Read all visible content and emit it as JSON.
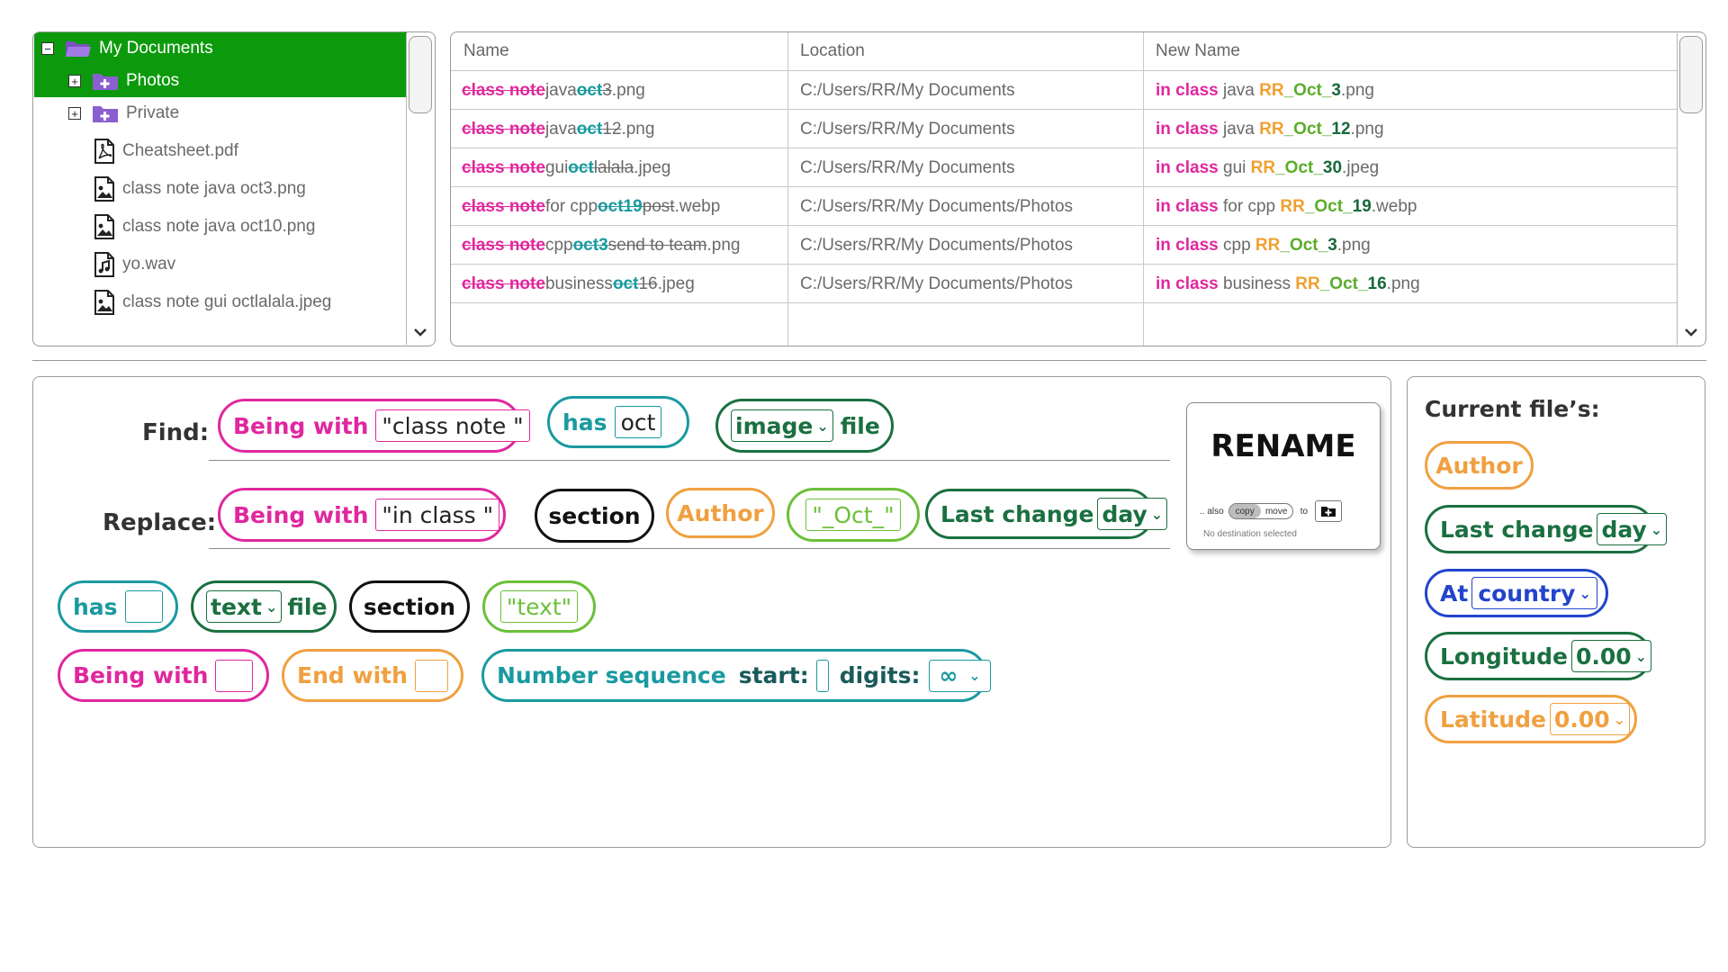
{
  "tree": {
    "items": [
      {
        "label": "My Documents",
        "type": "folder-open",
        "expander": "−",
        "selected": true
      },
      {
        "label": "Photos",
        "type": "folder",
        "expander": "+",
        "selected": true
      },
      {
        "label": "Private",
        "type": "folder",
        "expander": "+",
        "selected": false
      },
      {
        "label": "Cheatsheet.pdf",
        "type": "pdf"
      },
      {
        "label": "class note java oct3.png",
        "type": "image"
      },
      {
        "label": "class note java oct10.png",
        "type": "image"
      },
      {
        "label": "yo.wav",
        "type": "audio"
      },
      {
        "label": "class note gui octlalala.jpeg",
        "type": "image"
      }
    ]
  },
  "table": {
    "headers": {
      "name": "Name",
      "location": "Location",
      "new_name": "New Name"
    },
    "rows": [
      {
        "name": {
          "p1": "class note ",
          "p2": "java ",
          "p3": "oct",
          "p4": "3.png"
        },
        "location": "C:/Users/RR/My Documents",
        "new": {
          "a": "in class",
          " b": "",
          "b": " java ",
          "c": "RR_Oct_",
          "d": "3",
          ".ext": "",
          "e": ".png"
        }
      },
      {
        "name": {
          "p1": "class note ",
          "p2": "java ",
          "p3": "oct",
          "p4": "12.png"
        },
        "location": "C:/Users/RR/My Documents",
        "new": {
          "a": "in class",
          "b": " java ",
          "c": "RR_Oct_",
          "d": "12",
          "e": ".png"
        }
      },
      {
        "name": {
          "p1": "class note ",
          "p2": "gui ",
          "p3": "oct",
          "p4": "lalala.jpeg"
        },
        "location": "C:/Users/RR/My Documents",
        "new": {
          "a": "in class",
          "b": " gui ",
          "c": "RR_Oct_",
          "d": "30",
          "e": ".jpeg"
        }
      },
      {
        "name": {
          "p1": "class note ",
          "p2": "for cpp ",
          "p3": "oct19",
          "p4": " post.webp"
        },
        "location": "C:/Users/RR/My Documents/Photos",
        "new": {
          "a": "in class",
          "b": " for cpp ",
          "c": "RR_Oct_",
          "d": "19",
          "e": ".webp"
        }
      },
      {
        "name": {
          "p1": "class note ",
          "p2": "cpp ",
          "p3": "oct3",
          "p4": " send to team.png"
        },
        "location": "C:/Users/RR/My Documents/Photos",
        "new": {
          "a": "in class",
          "b": " cpp ",
          "c": "RR_Oct_",
          "d": "3",
          "e": ".png"
        }
      },
      {
        "name": {
          "p1": "class note ",
          "p2": "business ",
          "p3": "oct",
          "p4": "16.jpeg"
        },
        "location": "C:/Users/RR/My Documents/Photos",
        "new": {
          "a": "in class",
          "b": " business ",
          "c": "RR_Oct_",
          "d": "16",
          "e": ".png"
        }
      }
    ]
  },
  "find": {
    "label": "Find:",
    "begin_label": "Being with",
    "begin_value": "\"class note \"",
    "has_label": "has",
    "has_value": "oct",
    "type_value": "image",
    "file_label": "file"
  },
  "replace": {
    "label": "Replace:",
    "begin_label": "Being with",
    "begin_value": "\"in class \"",
    "section": "section",
    "author": "Author",
    "oct_value": "\"_Oct_\"",
    "last_change": "Last change",
    "last_change_value": "day"
  },
  "palette": {
    "has": "has",
    "text_value": "text",
    "file_label": "file",
    "section": "section",
    "text_literal": "\"text\"",
    "being_with": "Being with",
    "end_with": "End with",
    "number_sequence": "Number sequence",
    "start_label": "start:",
    "digits_label": "digits:",
    "digits_value": "∞"
  },
  "rename": {
    "title": "RENAME",
    "also": ".. also",
    "copy": "copy",
    "move": "move",
    "to": "to",
    "status": "No destination selected"
  },
  "current": {
    "title": "Current file’s:",
    "author": "Author",
    "last_change": "Last change",
    "last_change_value": "day",
    "at": "At",
    "at_value": "country",
    "longitude": "Longitude",
    "longitude_value": "0.00",
    "latitude": "Latitude",
    "latitude_value": "0.00"
  },
  "colors": {
    "pink": "#e0279e",
    "teal": "#1a9aa0",
    "dark_green": "#1a7040",
    "orange": "#f0a040",
    "light_green": "#6cc03a",
    "blue": "#2244cc",
    "selection": "#0c9a0c",
    "folder": "#8a5fd0"
  }
}
